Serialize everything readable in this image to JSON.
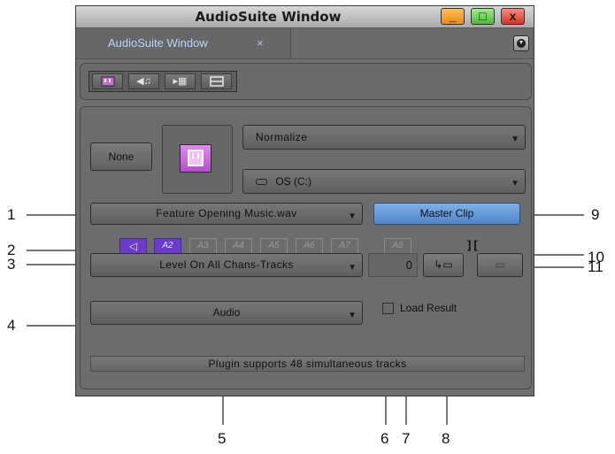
{
  "window": {
    "title": "AudioSuite Window",
    "controls": {
      "minimize": "_",
      "maximize": "□",
      "close": "x"
    }
  },
  "tab": {
    "label": "AudioSuite Window",
    "close": "×"
  },
  "toolbar": {
    "tools": [
      "plugin-icon",
      "speaker-icon",
      "timeline-icon",
      "split-icon"
    ]
  },
  "plugin": {
    "preset_button": "None",
    "plugin_name": "Normalize",
    "destination": "OS (C:)",
    "clip_name": "Feature Opening Music.wav",
    "master_clip_button": "Master Clip",
    "channels": [
      "A2",
      "A3",
      "A4",
      "A5",
      "A6",
      "A7",
      "A8"
    ],
    "track_mode": "Level On All Chans-Tracks",
    "output_type": "Audio",
    "handle_length": "0",
    "load_result_label": "Load Result",
    "load_result_checked": false,
    "status": "Plugin supports 48 simultaneous tracks"
  },
  "callouts": [
    "1",
    "2",
    "3",
    "4",
    "5",
    "6",
    "7",
    "8",
    "9",
    "10",
    "11"
  ],
  "colors": {
    "accent_purple": "#6a3cc8",
    "master_clip_blue": "#5b8fcf",
    "tab_text": "#b9d2ff"
  }
}
